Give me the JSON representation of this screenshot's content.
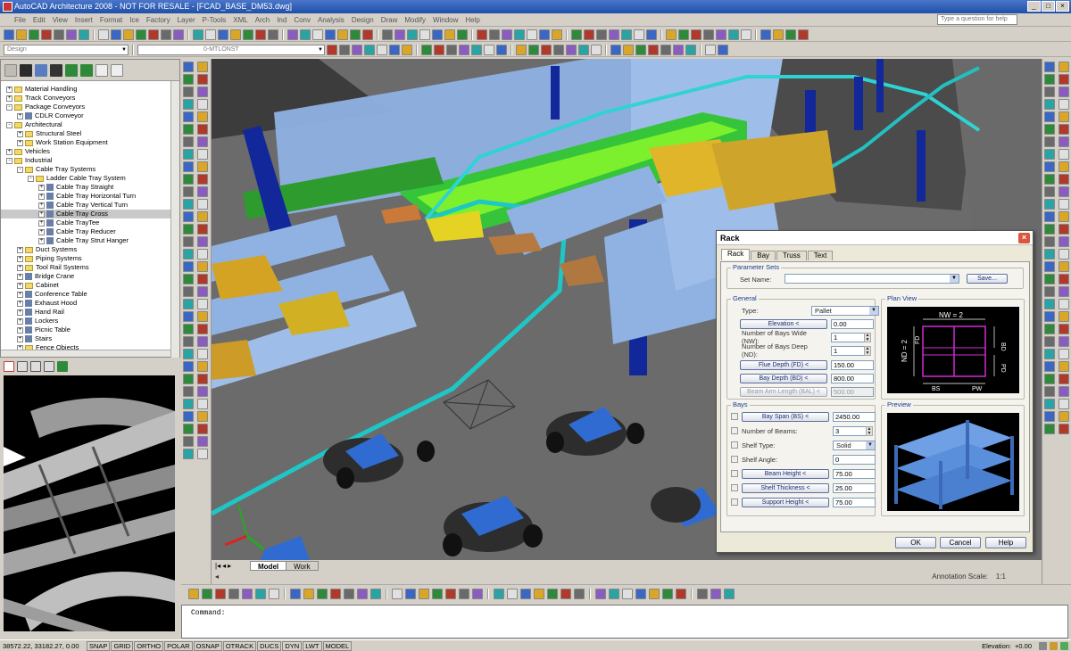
{
  "window": {
    "title": "AutoCAD Architecture 2008 - NOT FOR RESALE - [FCAD_BASE_DM53.dwg]",
    "help_placeholder": "Type a question for help"
  },
  "menu": [
    "File",
    "Edit",
    "View",
    "Insert",
    "Format",
    "Ice",
    "Factory",
    "Layer",
    "P-Tools",
    "XML",
    "Arch",
    "Ind",
    "Conv",
    "Analysis",
    "Design",
    "Draw",
    "Modify",
    "Window",
    "Help"
  ],
  "toolbar": {
    "workspace": "Design",
    "layer": "0-MTLONST"
  },
  "tree": [
    {
      "label": "Material Handling",
      "level": 1,
      "type": "folder",
      "exp": "+"
    },
    {
      "label": "Track Conveyors",
      "level": 1,
      "type": "folder",
      "exp": "+"
    },
    {
      "label": "Package Conveyors",
      "level": 1,
      "type": "folder",
      "exp": "-"
    },
    {
      "label": "CDLR Conveyor",
      "level": 2,
      "type": "leaf",
      "exp": "+"
    },
    {
      "label": "Architectural",
      "level": 1,
      "type": "folder",
      "exp": "-"
    },
    {
      "label": "Structural Steel",
      "level": 2,
      "type": "folder",
      "exp": "+"
    },
    {
      "label": "Work Station Equipment",
      "level": 2,
      "type": "folder",
      "exp": "+"
    },
    {
      "label": "Vehicles",
      "level": 1,
      "type": "folder",
      "exp": "+"
    },
    {
      "label": "Industrial",
      "level": 1,
      "type": "folder",
      "exp": "-"
    },
    {
      "label": "Cable Tray Systems",
      "level": 2,
      "type": "folder",
      "exp": "-"
    },
    {
      "label": "Ladder Cable Tray System",
      "level": 3,
      "type": "folder",
      "exp": "-"
    },
    {
      "label": "Cable Tray Straight",
      "level": 4,
      "type": "leaf",
      "exp": "+"
    },
    {
      "label": "Cable Tray Horizontal Turn",
      "level": 4,
      "type": "leaf",
      "exp": "+"
    },
    {
      "label": "Cable Tray Vertical Turn",
      "level": 4,
      "type": "leaf",
      "exp": "+"
    },
    {
      "label": "Cable Tray Cross",
      "level": 4,
      "type": "leaf",
      "exp": "+",
      "selected": true
    },
    {
      "label": "Cable TrayTee",
      "level": 4,
      "type": "leaf",
      "exp": "+"
    },
    {
      "label": "Cable Tray Reducer",
      "level": 4,
      "type": "leaf",
      "exp": "+"
    },
    {
      "label": "Cable Tray Strut Hanger",
      "level": 4,
      "type": "leaf",
      "exp": "+"
    },
    {
      "label": "Duct Systems",
      "level": 2,
      "type": "folder",
      "exp": "+"
    },
    {
      "label": "Piping Systems",
      "level": 2,
      "type": "folder",
      "exp": "+"
    },
    {
      "label": "Tool Rail Systems",
      "level": 2,
      "type": "folder",
      "exp": "+"
    },
    {
      "label": "Bridge Crane",
      "level": 2,
      "type": "leaf",
      "exp": "+"
    },
    {
      "label": "Cabinet",
      "level": 2,
      "type": "folder",
      "exp": "+"
    },
    {
      "label": "Conference Table",
      "level": 2,
      "type": "leaf",
      "exp": "+"
    },
    {
      "label": "Exhaust Hood",
      "level": 2,
      "type": "leaf",
      "exp": "+"
    },
    {
      "label": "Hand Rail",
      "level": 2,
      "type": "leaf",
      "exp": "+"
    },
    {
      "label": "Lockers",
      "level": 2,
      "type": "leaf",
      "exp": "+"
    },
    {
      "label": "Picnic Table",
      "level": 2,
      "type": "leaf",
      "exp": "+"
    },
    {
      "label": "Stairs",
      "level": 2,
      "type": "leaf",
      "exp": "+"
    },
    {
      "label": "Fence Objects",
      "level": 2,
      "type": "folder",
      "exp": "+"
    }
  ],
  "layout_tabs": {
    "model": "Model",
    "work": "Work"
  },
  "annotation": {
    "label": "Annotation Scale:",
    "value": "1:1"
  },
  "command": {
    "prompt": "Command:"
  },
  "status": {
    "coords": "38572.22, 33182.27, 0.00",
    "buttons": [
      "SNAP",
      "GRID",
      "ORTHO",
      "POLAR",
      "OSNAP",
      "OTRACK",
      "DUCS",
      "DYN",
      "LWT",
      "MODEL"
    ],
    "elevation_label": "Elevation:",
    "elevation_value": "+0.00"
  },
  "dialog": {
    "title": "Rack",
    "tabs": [
      "Rack",
      "Bay",
      "Truss",
      "Text"
    ],
    "param_sets": {
      "label": "Parameter Sets",
      "set_name_label": "Set Name:",
      "set_name_value": "",
      "save": "Save..."
    },
    "general": {
      "label": "General",
      "type_label": "Type:",
      "type_value": "Pallet",
      "elevation_btn": "Elevation <",
      "elevation_value": "0.00",
      "nw_label": "Number of Bays Wide (NW):",
      "nw_value": "1",
      "nd_label": "Number of Bays Deep (ND):",
      "nd_value": "1",
      "fd_btn": "Flue Depth (FD) <",
      "fd_value": "150.00",
      "bd_btn": "Bay Depth (BD) <",
      "bd_value": "800.00",
      "bal_btn": "Beam Arm Length (BAL) <",
      "bal_value": "500.00"
    },
    "bays": {
      "label": "Bays",
      "bs_btn": "Bay Span (BS) <",
      "bs_value": "2450.00",
      "beams_label": "Number of Beams:",
      "beams_value": "3",
      "shelf_type_label": "Shelf Type:",
      "shelf_type_value": "Solid",
      "shelf_angle_label": "Shelf Angle:",
      "shelf_angle_value": "0",
      "beam_height_btn": "Beam Height <",
      "beam_height_value": "75.00",
      "shelf_thick_btn": "Shelf Thickness <",
      "shelf_thick_value": "25.00",
      "support_height_btn": "Support Height <",
      "support_height_value": "75.00"
    },
    "plan_view": {
      "label": "Plan View",
      "nw": "NW = 2",
      "nd": "ND = 2",
      "fd": "FD",
      "bd": "BD",
      "bs": "BS",
      "pw": "PW",
      "pd": "PD"
    },
    "preview": {
      "label": "Preview"
    },
    "buttons": {
      "ok": "OK",
      "cancel": "Cancel",
      "help": "Help"
    }
  }
}
